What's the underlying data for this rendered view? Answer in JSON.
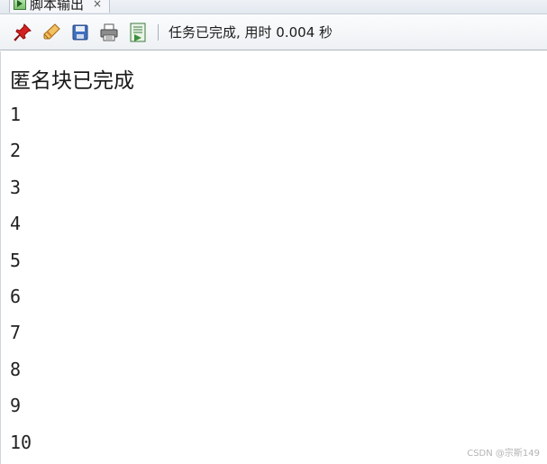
{
  "tab": {
    "title": "脚本输出",
    "close_glyph": "×",
    "icon": "script-output-icon"
  },
  "toolbar": {
    "buttons": [
      {
        "icon": "pin-icon",
        "color": "#d42020"
      },
      {
        "icon": "eraser-icon",
        "color": "#e8a040"
      },
      {
        "icon": "save-icon",
        "color": "#3f6fbf"
      },
      {
        "icon": "print-icon",
        "color": "#6a6a6a"
      },
      {
        "icon": "save-output-icon",
        "color": "#3d8f3d"
      }
    ],
    "status": "任务已完成, 用时 0.004 秒"
  },
  "output": {
    "header": "匿名块已完成",
    "lines": [
      "1",
      "2",
      "3",
      "4",
      "5",
      "6",
      "7",
      "8",
      "9",
      "10"
    ]
  },
  "watermark": "CSDN @宗斯149"
}
